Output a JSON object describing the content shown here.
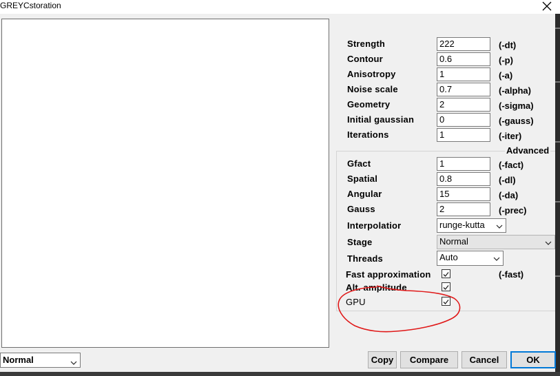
{
  "window": {
    "title": "GREYCstoration",
    "close_glyph": "✕"
  },
  "params": [
    {
      "label": "Strength",
      "value": "222",
      "flag": "(-dt)"
    },
    {
      "label": "Contour",
      "value": "0.6",
      "flag": "(-p)"
    },
    {
      "label": "Anisotropy",
      "value": "1",
      "flag": "(-a)"
    },
    {
      "label": "Noise scale",
      "value": "0.7",
      "flag": "(-alpha)"
    },
    {
      "label": "Geometry",
      "value": "2",
      "flag": "(-sigma)"
    },
    {
      "label": "Initial gaussian",
      "value": "0",
      "flag": "(-gauss)"
    },
    {
      "label": "Iterations",
      "value": "1",
      "flag": "(-iter)"
    }
  ],
  "advanced": {
    "legend": "Advanced",
    "params": [
      {
        "label": "Gfact",
        "value": "1",
        "flag": "(-fact)"
      },
      {
        "label": "Spatial",
        "value": "0.8",
        "flag": "(-dl)"
      },
      {
        "label": "Angular",
        "value": "15",
        "flag": "(-da)"
      },
      {
        "label": "Gauss",
        "value": "2",
        "flag": "(-prec)"
      }
    ],
    "interpolation": {
      "label": "Interpolatior",
      "value": "runge-kutta"
    },
    "stage": {
      "label": "Stage",
      "value": "Normal"
    },
    "threads": {
      "label": "Threads",
      "value": "Auto"
    },
    "fast_approx": {
      "label": "Fast approximation",
      "checked": true,
      "flag": "(-fast)"
    },
    "alt_amplitude": {
      "label": "Alt. amplitude",
      "checked": true
    },
    "gpu": {
      "label": "GPU",
      "checked": true
    }
  },
  "bottom": {
    "view_mode": "Normal",
    "copy_label": "Copy",
    "compare_label": "Compare",
    "cancel_label": "Cancel",
    "ok_label": "OK"
  },
  "colors": {
    "annotation_red": "#e01818",
    "ok_focus_border": "#0078d7"
  },
  "icons": {
    "close": "close-icon",
    "dropdown": "chevron-down-icon",
    "check": "checkmark-icon"
  }
}
